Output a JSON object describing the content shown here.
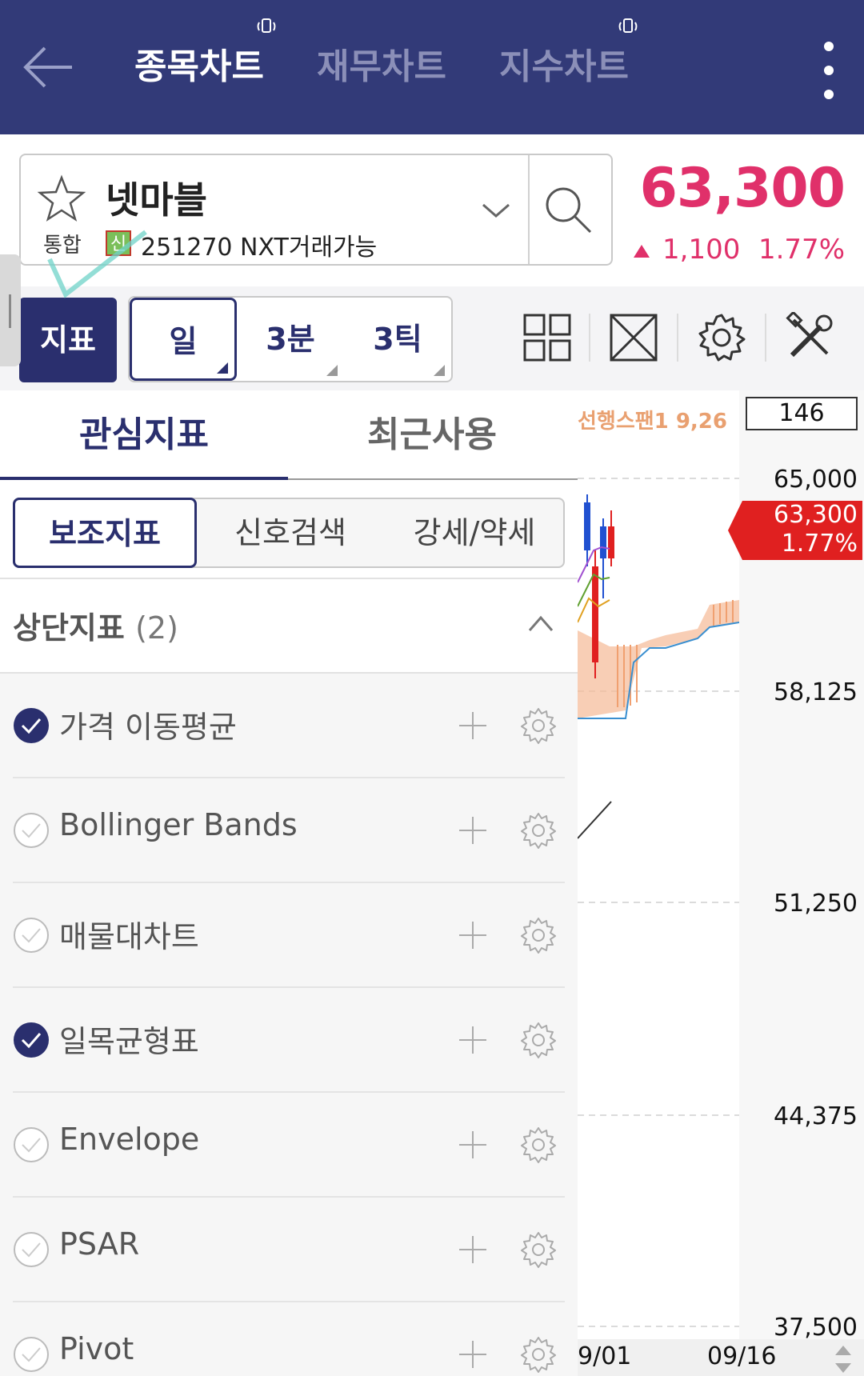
{
  "topbar": {
    "tabs": [
      {
        "label": "종목차트",
        "active": true
      },
      {
        "label": "재무차트",
        "active": false
      },
      {
        "label": "지수차트",
        "active": false
      }
    ]
  },
  "stock": {
    "name": "넷마블",
    "market": "통합",
    "credit_badge": "신",
    "code_line": "251270 NXT거래가능",
    "price": "63,300",
    "change": "1,100",
    "change_pct": "1.77%",
    "up_color": "#e0306a"
  },
  "toolbar": {
    "indicator_label": "지표",
    "periods": [
      {
        "label": "일",
        "selected": true
      },
      {
        "label": "3분",
        "selected": false
      },
      {
        "label": "3틱",
        "selected": false
      }
    ],
    "icons": [
      "grid-layout-icon",
      "fullscreen-icon",
      "settings-icon",
      "tools-icon"
    ]
  },
  "chart": {
    "ichimoku_label": "선행스팬1 9,26",
    "crosshair_value": "146",
    "current_price": "63,300",
    "current_pct": "1.77%",
    "price_axis": [
      "65,000",
      "58,125",
      "51,250",
      "44,375",
      "37,500"
    ],
    "date_axis": [
      "09/01",
      "09/16"
    ],
    "visible_date_first": "9/01"
  },
  "panel": {
    "tabs": [
      {
        "label": "관심지표",
        "active": true
      },
      {
        "label": "최근사용",
        "active": false
      }
    ],
    "segments": [
      {
        "label": "보조지표",
        "active": true
      },
      {
        "label": "신호검색",
        "active": false
      },
      {
        "label": "강세/약세",
        "active": false
      }
    ],
    "section": {
      "title": "상단지표",
      "count": "(2)"
    },
    "indicators": [
      {
        "label": "가격 이동평균",
        "checked": true
      },
      {
        "label": "Bollinger Bands",
        "checked": false
      },
      {
        "label": "매물대차트",
        "checked": false
      },
      {
        "label": "일목균형표",
        "checked": true
      },
      {
        "label": "Envelope",
        "checked": false
      },
      {
        "label": "PSAR",
        "checked": false
      },
      {
        "label": "Pivot",
        "checked": false
      }
    ]
  },
  "colors": {
    "nav_bg": "#323a78",
    "accent": "#2a2f6e",
    "up": "#e0306a",
    "current_tag": "#e02020",
    "cloud": "#f0a070"
  }
}
